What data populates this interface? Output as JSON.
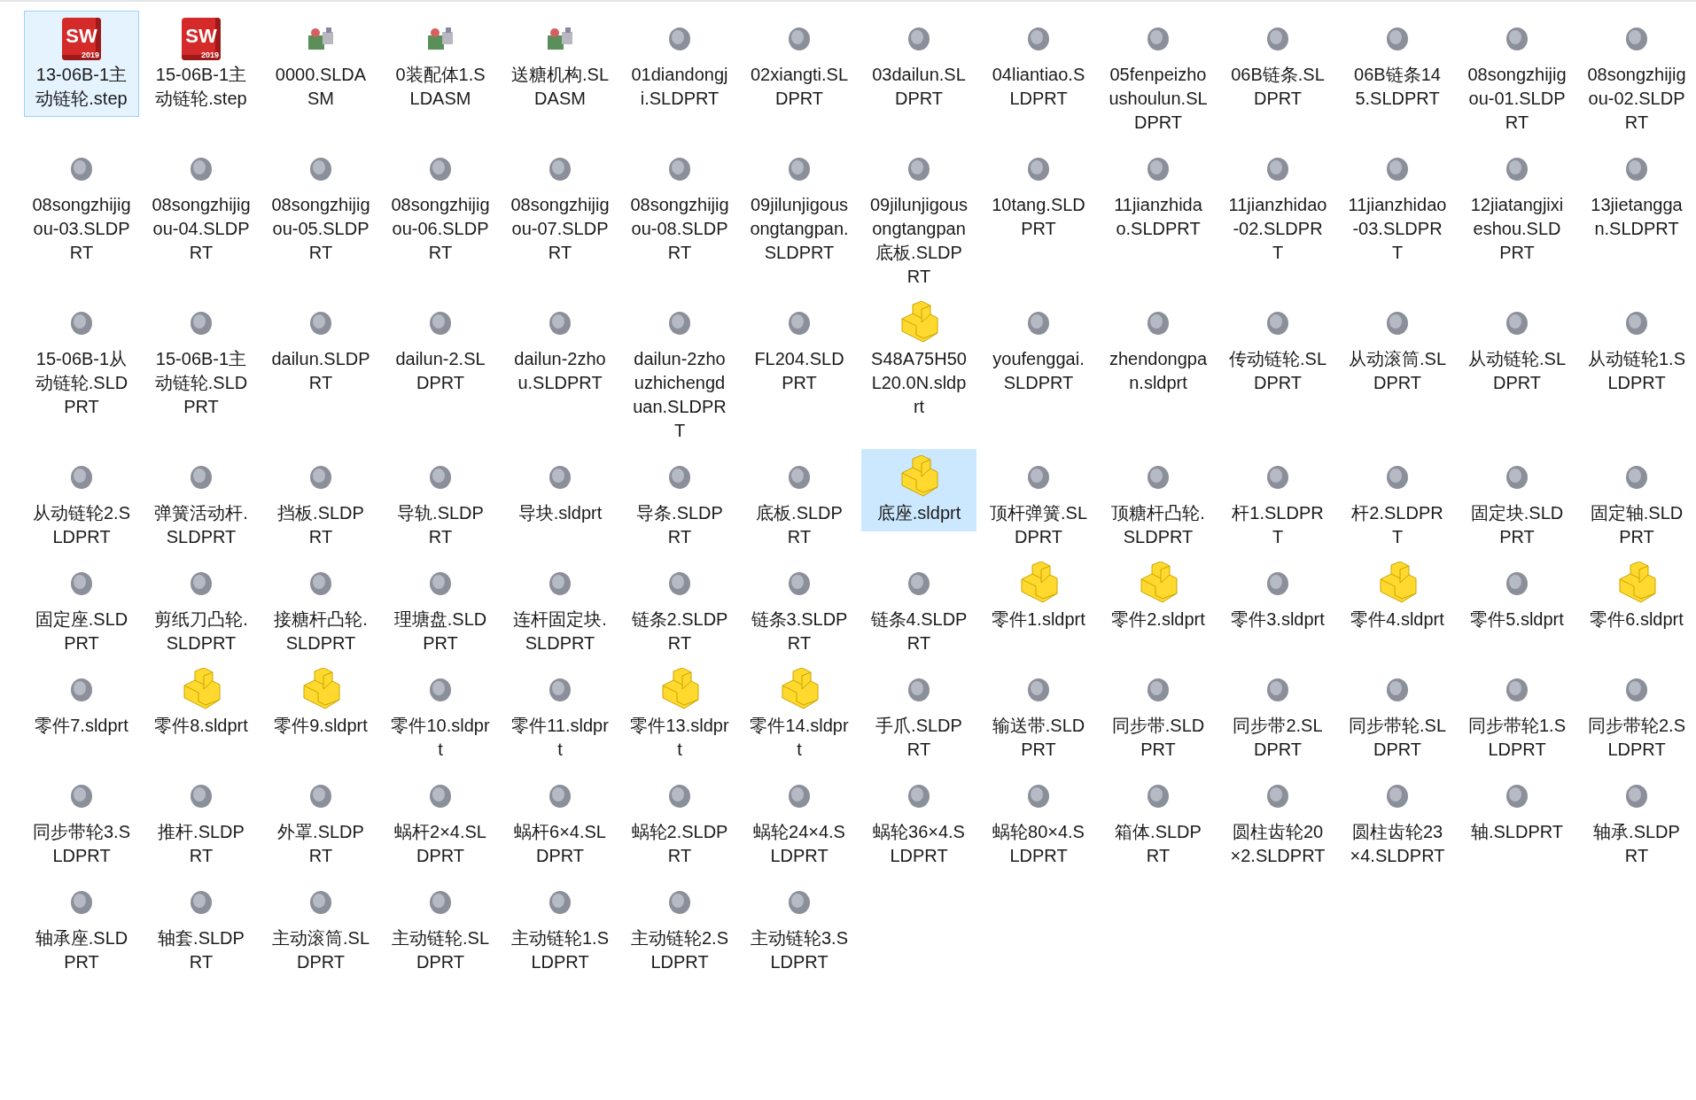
{
  "items": [
    {
      "name": "13-06B-1主动链轮.step",
      "kind": "sw",
      "logo": "SW",
      "logo_year": "2019",
      "selected": true,
      "focused": true
    },
    {
      "name": "15-06B-1主动链轮.step",
      "kind": "sw",
      "logo": "SW",
      "logo_year": "2019",
      "selected": false,
      "focused": false
    },
    {
      "name": "0000.SLDASM",
      "kind": "assembly",
      "selected": false,
      "focused": false
    },
    {
      "name": "0装配体1.SLDASM",
      "kind": "assembly",
      "selected": false,
      "focused": false
    },
    {
      "name": "送糖机构.SLDASM",
      "kind": "assembly",
      "selected": false,
      "focused": false
    },
    {
      "name": "01diandongji.SLDPRT",
      "kind": "thumbnail",
      "selected": false,
      "focused": false
    },
    {
      "name": "02xiangti.SLDPRT",
      "kind": "thumbnail",
      "selected": false,
      "focused": false
    },
    {
      "name": "03dailun.SLDPRT",
      "kind": "thumbnail",
      "selected": false,
      "focused": false
    },
    {
      "name": "04liantiao.SLDPRT",
      "kind": "thumbnail",
      "selected": false,
      "focused": false
    },
    {
      "name": "05fenpeizhoushoulun.SLDPRT",
      "kind": "thumbnail",
      "selected": false,
      "focused": false
    },
    {
      "name": "06B链条.SLDPRT",
      "kind": "thumbnail",
      "selected": false,
      "focused": false
    },
    {
      "name": "06B链条145.SLDPRT",
      "kind": "thumbnail",
      "selected": false,
      "focused": false
    },
    {
      "name": "08songzhijigou-01.SLDPRT",
      "kind": "thumbnail",
      "selected": false,
      "focused": false
    },
    {
      "name": "08songzhijigou-02.SLDPRT",
      "kind": "thumbnail",
      "selected": false,
      "focused": false
    },
    {
      "name": "08songzhijigou-03.SLDPRT",
      "kind": "thumbnail",
      "selected": false,
      "focused": false
    },
    {
      "name": "08songzhijigou-04.SLDPRT",
      "kind": "thumbnail",
      "selected": false,
      "focused": false
    },
    {
      "name": "08songzhijigou-05.SLDPRT",
      "kind": "thumbnail",
      "selected": false,
      "focused": false
    },
    {
      "name": "08songzhijigou-06.SLDPRT",
      "kind": "thumbnail",
      "selected": false,
      "focused": false
    },
    {
      "name": "08songzhijigou-07.SLDPRT",
      "kind": "thumbnail",
      "selected": false,
      "focused": false
    },
    {
      "name": "08songzhijigou-08.SLDPRT",
      "kind": "thumbnail",
      "selected": false,
      "focused": false
    },
    {
      "name": "09jilunjigousongtangpan.SLDPRT",
      "kind": "thumbnail",
      "selected": false,
      "focused": false
    },
    {
      "name": "09jilunjigousongtangpan底板.SLDPRT",
      "kind": "thumbnail",
      "selected": false,
      "focused": false
    },
    {
      "name": "10tang.SLDPRT",
      "kind": "thumbnail",
      "selected": false,
      "focused": false
    },
    {
      "name": "11jianzhidao.SLDPRT",
      "kind": "thumbnail",
      "selected": false,
      "focused": false
    },
    {
      "name": "11jianzhidao-02.SLDPRT",
      "kind": "thumbnail",
      "selected": false,
      "focused": false
    },
    {
      "name": "11jianzhidao-03.SLDPRT",
      "kind": "thumbnail",
      "selected": false,
      "focused": false
    },
    {
      "name": "12jiatangjixieshou.SLDPRT",
      "kind": "thumbnail",
      "selected": false,
      "focused": false
    },
    {
      "name": "13jietanggan.SLDPRT",
      "kind": "thumbnail",
      "selected": false,
      "focused": false
    },
    {
      "name": "15-06B-1从动链轮.SLDPRT",
      "kind": "thumbnail",
      "selected": false,
      "focused": false
    },
    {
      "name": "15-06B-1主动链轮.SLDPRT",
      "kind": "thumbnail",
      "selected": false,
      "focused": false
    },
    {
      "name": "dailun.SLDPRT",
      "kind": "thumbnail",
      "selected": false,
      "focused": false
    },
    {
      "name": "dailun-2.SLDPRT",
      "kind": "thumbnail",
      "selected": false,
      "focused": false
    },
    {
      "name": "dailun-2zhou.SLDPRT",
      "kind": "thumbnail",
      "selected": false,
      "focused": false
    },
    {
      "name": "dailun-2zhouzhichengduan.SLDPRT",
      "kind": "thumbnail",
      "selected": false,
      "focused": false
    },
    {
      "name": "FL204.SLDPRT",
      "kind": "thumbnail",
      "selected": false,
      "focused": false
    },
    {
      "name": "S48A75H50L20.0N.sldprt",
      "kind": "part",
      "selected": false,
      "focused": false
    },
    {
      "name": "youfenggai.SLDPRT",
      "kind": "thumbnail",
      "selected": false,
      "focused": false
    },
    {
      "name": "zhendongpan.sldprt",
      "kind": "thumbnail",
      "selected": false,
      "focused": false
    },
    {
      "name": "传动链轮.SLDPRT",
      "kind": "thumbnail",
      "selected": false,
      "focused": false
    },
    {
      "name": "从动滚筒.SLDPRT",
      "kind": "thumbnail",
      "selected": false,
      "focused": false
    },
    {
      "name": "从动链轮.SLDPRT",
      "kind": "thumbnail",
      "selected": false,
      "focused": false
    },
    {
      "name": "从动链轮1.SLDPRT",
      "kind": "thumbnail",
      "selected": false,
      "focused": false
    },
    {
      "name": "从动链轮2.SLDPRT",
      "kind": "thumbnail",
      "selected": false,
      "focused": false
    },
    {
      "name": "弹簧活动杆.SLDPRT",
      "kind": "thumbnail",
      "selected": false,
      "focused": false
    },
    {
      "name": "挡板.SLDPRT",
      "kind": "thumbnail",
      "selected": false,
      "focused": false
    },
    {
      "name": "导轨.SLDPRT",
      "kind": "thumbnail",
      "selected": false,
      "focused": false
    },
    {
      "name": "导块.sldprt",
      "kind": "thumbnail",
      "selected": false,
      "focused": false
    },
    {
      "name": "导条.SLDPRT",
      "kind": "thumbnail",
      "selected": false,
      "focused": false
    },
    {
      "name": "底板.SLDPRT",
      "kind": "thumbnail",
      "selected": false,
      "focused": false
    },
    {
      "name": "底座.sldprt",
      "kind": "part",
      "selected": true,
      "focused": false
    },
    {
      "name": "顶杆弹簧.SLDPRT",
      "kind": "thumbnail",
      "selected": false,
      "focused": false
    },
    {
      "name": "顶糖杆凸轮.SLDPRT",
      "kind": "thumbnail",
      "selected": false,
      "focused": false
    },
    {
      "name": "杆1.SLDPRT",
      "kind": "thumbnail",
      "selected": false,
      "focused": false
    },
    {
      "name": "杆2.SLDPRT",
      "kind": "thumbnail",
      "selected": false,
      "focused": false
    },
    {
      "name": "固定块.SLDPRT",
      "kind": "thumbnail",
      "selected": false,
      "focused": false
    },
    {
      "name": "固定轴.SLDPRT",
      "kind": "thumbnail",
      "selected": false,
      "focused": false
    },
    {
      "name": "固定座.SLDPRT",
      "kind": "thumbnail",
      "selected": false,
      "focused": false
    },
    {
      "name": "剪纸刀凸轮.SLDPRT",
      "kind": "thumbnail",
      "selected": false,
      "focused": false
    },
    {
      "name": "接糖杆凸轮.SLDPRT",
      "kind": "thumbnail",
      "selected": false,
      "focused": false
    },
    {
      "name": "理塘盘.SLDPRT",
      "kind": "thumbnail",
      "selected": false,
      "focused": false
    },
    {
      "name": "连杆固定块.SLDPRT",
      "kind": "thumbnail",
      "selected": false,
      "focused": false
    },
    {
      "name": "链条2.SLDPRT",
      "kind": "thumbnail",
      "selected": false,
      "focused": false
    },
    {
      "name": "链条3.SLDPRT",
      "kind": "thumbnail",
      "selected": false,
      "focused": false
    },
    {
      "name": "链条4.SLDPRT",
      "kind": "thumbnail",
      "selected": false,
      "focused": false
    },
    {
      "name": "零件1.sldprt",
      "kind": "part",
      "selected": false,
      "focused": false
    },
    {
      "name": "零件2.sldprt",
      "kind": "part",
      "selected": false,
      "focused": false
    },
    {
      "name": "零件3.sldprt",
      "kind": "thumbnail",
      "selected": false,
      "focused": false
    },
    {
      "name": "零件4.sldprt",
      "kind": "part",
      "selected": false,
      "focused": false
    },
    {
      "name": "零件5.sldprt",
      "kind": "thumbnail",
      "selected": false,
      "focused": false
    },
    {
      "name": "零件6.sldprt",
      "kind": "part",
      "selected": false,
      "focused": false
    },
    {
      "name": "零件7.sldprt",
      "kind": "thumbnail",
      "selected": false,
      "focused": false
    },
    {
      "name": "零件8.sldprt",
      "kind": "part",
      "selected": false,
      "focused": false
    },
    {
      "name": "零件9.sldprt",
      "kind": "part",
      "selected": false,
      "focused": false
    },
    {
      "name": "零件10.sldprt",
      "kind": "thumbnail",
      "selected": false,
      "focused": false
    },
    {
      "name": "零件11.sldprt",
      "kind": "thumbnail",
      "selected": false,
      "focused": false
    },
    {
      "name": "零件13.sldprt",
      "kind": "part",
      "selected": false,
      "focused": false
    },
    {
      "name": "零件14.sldprt",
      "kind": "part",
      "selected": false,
      "focused": false
    },
    {
      "name": "手爪.SLDPRT",
      "kind": "thumbnail",
      "selected": false,
      "focused": false
    },
    {
      "name": "输送带.SLDPRT",
      "kind": "thumbnail",
      "selected": false,
      "focused": false
    },
    {
      "name": "同步带.SLDPRT",
      "kind": "thumbnail",
      "selected": false,
      "focused": false
    },
    {
      "name": "同步带2.SLDPRT",
      "kind": "thumbnail",
      "selected": false,
      "focused": false
    },
    {
      "name": "同步带轮.SLDPRT",
      "kind": "thumbnail",
      "selected": false,
      "focused": false
    },
    {
      "name": "同步带轮1.SLDPRT",
      "kind": "thumbnail",
      "selected": false,
      "focused": false
    },
    {
      "name": "同步带轮2.SLDPRT",
      "kind": "thumbnail",
      "selected": false,
      "focused": false
    },
    {
      "name": "同步带轮3.SLDPRT",
      "kind": "thumbnail",
      "selected": false,
      "focused": false
    },
    {
      "name": "推杆.SLDPRT",
      "kind": "thumbnail",
      "selected": false,
      "focused": false
    },
    {
      "name": "外罩.SLDPRT",
      "kind": "thumbnail",
      "selected": false,
      "focused": false
    },
    {
      "name": "蜗杆2×4.SLDPRT",
      "kind": "thumbnail",
      "selected": false,
      "focused": false
    },
    {
      "name": "蜗杆6×4.SLDPRT",
      "kind": "thumbnail",
      "selected": false,
      "focused": false
    },
    {
      "name": "蜗轮2.SLDPRT",
      "kind": "thumbnail",
      "selected": false,
      "focused": false
    },
    {
      "name": "蜗轮24×4.SLDPRT",
      "kind": "thumbnail",
      "selected": false,
      "focused": false
    },
    {
      "name": "蜗轮36×4.SLDPRT",
      "kind": "thumbnail",
      "selected": false,
      "focused": false
    },
    {
      "name": "蜗轮80×4.SLDPRT",
      "kind": "thumbnail",
      "selected": false,
      "focused": false
    },
    {
      "name": "箱体.SLDPRT",
      "kind": "thumbnail",
      "selected": false,
      "focused": false
    },
    {
      "name": "圆柱齿轮20×2.SLDPRT",
      "kind": "thumbnail",
      "selected": false,
      "focused": false
    },
    {
      "name": "圆柱齿轮23×4.SLDPRT",
      "kind": "thumbnail",
      "selected": false,
      "focused": false
    },
    {
      "name": "轴.SLDPRT",
      "kind": "thumbnail",
      "selected": false,
      "focused": false
    },
    {
      "name": "轴承.SLDPRT",
      "kind": "thumbnail",
      "selected": false,
      "focused": false
    },
    {
      "name": "轴承座.SLDPRT",
      "kind": "thumbnail",
      "selected": false,
      "focused": false
    },
    {
      "name": "轴套.SLDPRT",
      "kind": "thumbnail",
      "selected": false,
      "focused": false
    },
    {
      "name": "主动滚筒.SLDPRT",
      "kind": "thumbnail",
      "selected": false,
      "focused": false
    },
    {
      "name": "主动链轮.SLDPRT",
      "kind": "thumbnail",
      "selected": false,
      "focused": false
    },
    {
      "name": "主动链轮1.SLDPRT",
      "kind": "thumbnail",
      "selected": false,
      "focused": false
    },
    {
      "name": "主动链轮2.SLDPRT",
      "kind": "thumbnail",
      "selected": false,
      "focused": false
    },
    {
      "name": "主动链轮3.SLDPRT",
      "kind": "thumbnail",
      "selected": false,
      "focused": false
    }
  ]
}
